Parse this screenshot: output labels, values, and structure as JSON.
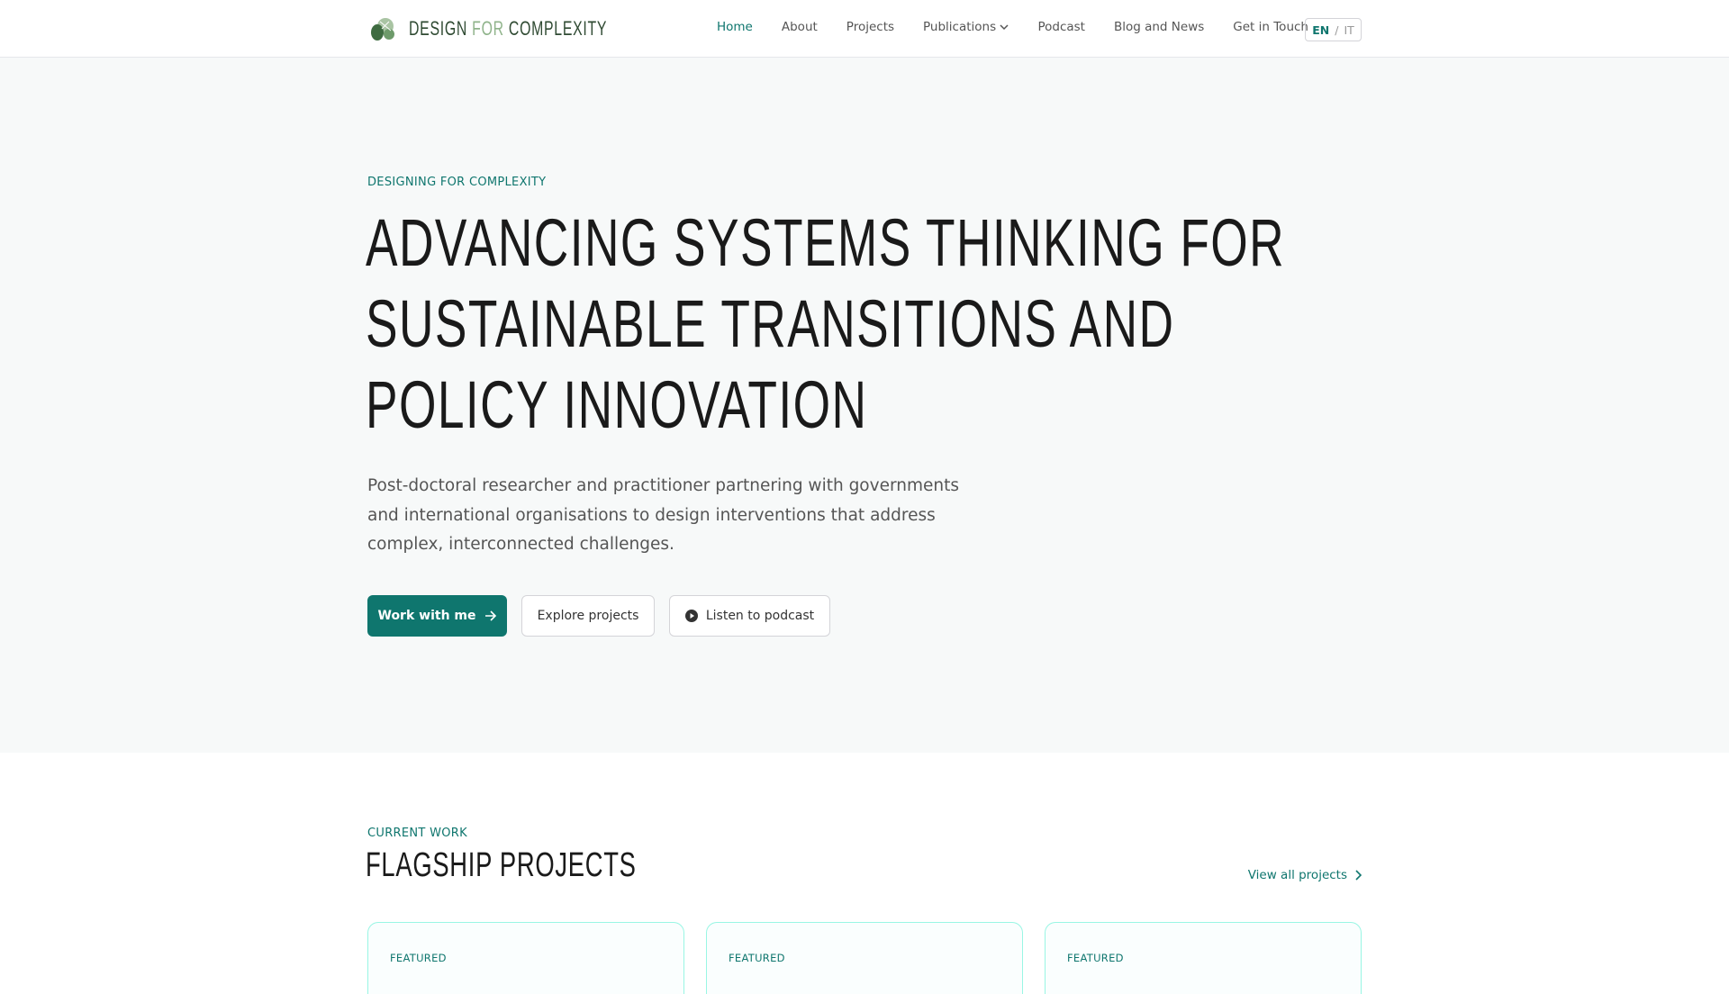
{
  "nav": {
    "logo_parts": [
      "DESIGN ",
      "FOR",
      " COMPLEXITY"
    ],
    "items": [
      "Home",
      "About",
      "Projects",
      "Publications",
      "Podcast",
      "Blog and News",
      "Get in Touch"
    ],
    "lang": {
      "active": "EN",
      "sep": "/",
      "other": "IT"
    }
  },
  "hero": {
    "eyebrow": "DESIGNING FOR COMPLEXITY",
    "title_lines": [
      "ADVANCING SYSTEMS THINKING FOR",
      "SUSTAINABLE TRANSITIONS AND",
      "POLICY INNOVATION"
    ],
    "lead": "Post-doctoral researcher and practitioner partnering with governments and international organisations to design interventions that address complex, interconnected challenges.",
    "buttons": {
      "work": "Work with me",
      "explore": "Explore projects",
      "podcast": "Listen to podcast"
    }
  },
  "projects": {
    "eyebrow": "CURRENT WORK",
    "title": "FLAGSHIP PROJECTS",
    "view_all": "View all projects",
    "cards": [
      {
        "badge": "FEATURED"
      },
      {
        "badge": "FEATURED"
      },
      {
        "badge": "FEATURED"
      }
    ]
  },
  "colors": {
    "accent": "#0f766e",
    "logo_dark": "#2f4a32",
    "logo_light": "#8fb38a"
  }
}
